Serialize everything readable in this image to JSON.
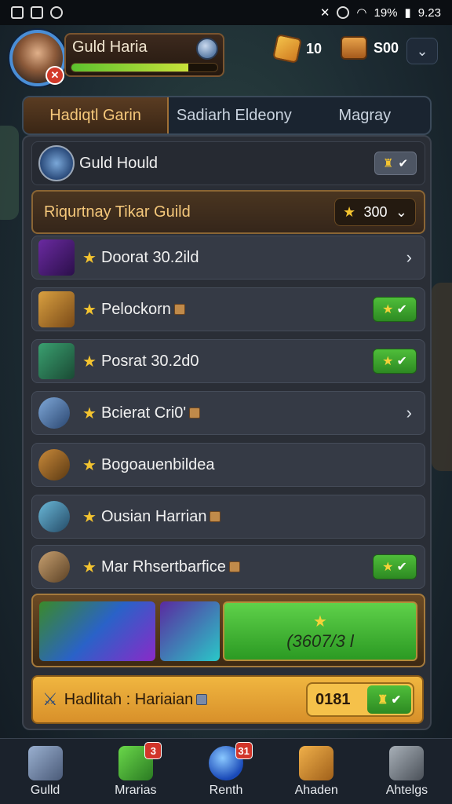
{
  "status_bar": {
    "time": "9.23",
    "battery": "19%"
  },
  "header": {
    "player_name": "Guld Haria",
    "xp_progress": 0.8,
    "currency_1": "10",
    "currency_2": "S00"
  },
  "tabs": [
    {
      "label": "Hadiqtl Garin",
      "active": true
    },
    {
      "label": "Sadiarh Eldeony",
      "active": false
    },
    {
      "label": "Magray",
      "active": false
    }
  ],
  "guild_row": {
    "label": "Guld Hould"
  },
  "featured_row": {
    "label": "Riqurtnay Tikar Guild",
    "price": "300"
  },
  "items": [
    {
      "label": "Doorat 30.2ild",
      "action": "chevron",
      "icon": "ornate-sword-icon"
    },
    {
      "label": "Pelockorn",
      "action": "claim",
      "icon": "treasure-chest-icon"
    },
    {
      "label": "Posrat 30.2d0",
      "action": "claim",
      "icon": "hero-portrait-icon"
    },
    {
      "label": "Bcierat Cri0'",
      "action": "chevron",
      "icon": "blue-dagger-icon"
    },
    {
      "label": "Bogoauenbildea",
      "action": "none",
      "icon": "golden-spear-icon"
    },
    {
      "label": "Ousian Harrian",
      "action": "none",
      "icon": "crystal-sword-icon"
    },
    {
      "label": "Mar Rhsertbarfice",
      "action": "claim",
      "icon": "axe-icon"
    }
  ],
  "reward_banner": {
    "code": "(3607/3 l"
  },
  "guild_bar": {
    "label": "Hadlitah : Hariaian",
    "price": "0181"
  },
  "nav": [
    {
      "label": "Gulld",
      "badge": ""
    },
    {
      "label": "Mrarias",
      "badge": "3"
    },
    {
      "label": "Renth",
      "badge": "31"
    },
    {
      "label": "Ahaden",
      "badge": ""
    },
    {
      "label": "Ahtelgs",
      "badge": ""
    }
  ]
}
